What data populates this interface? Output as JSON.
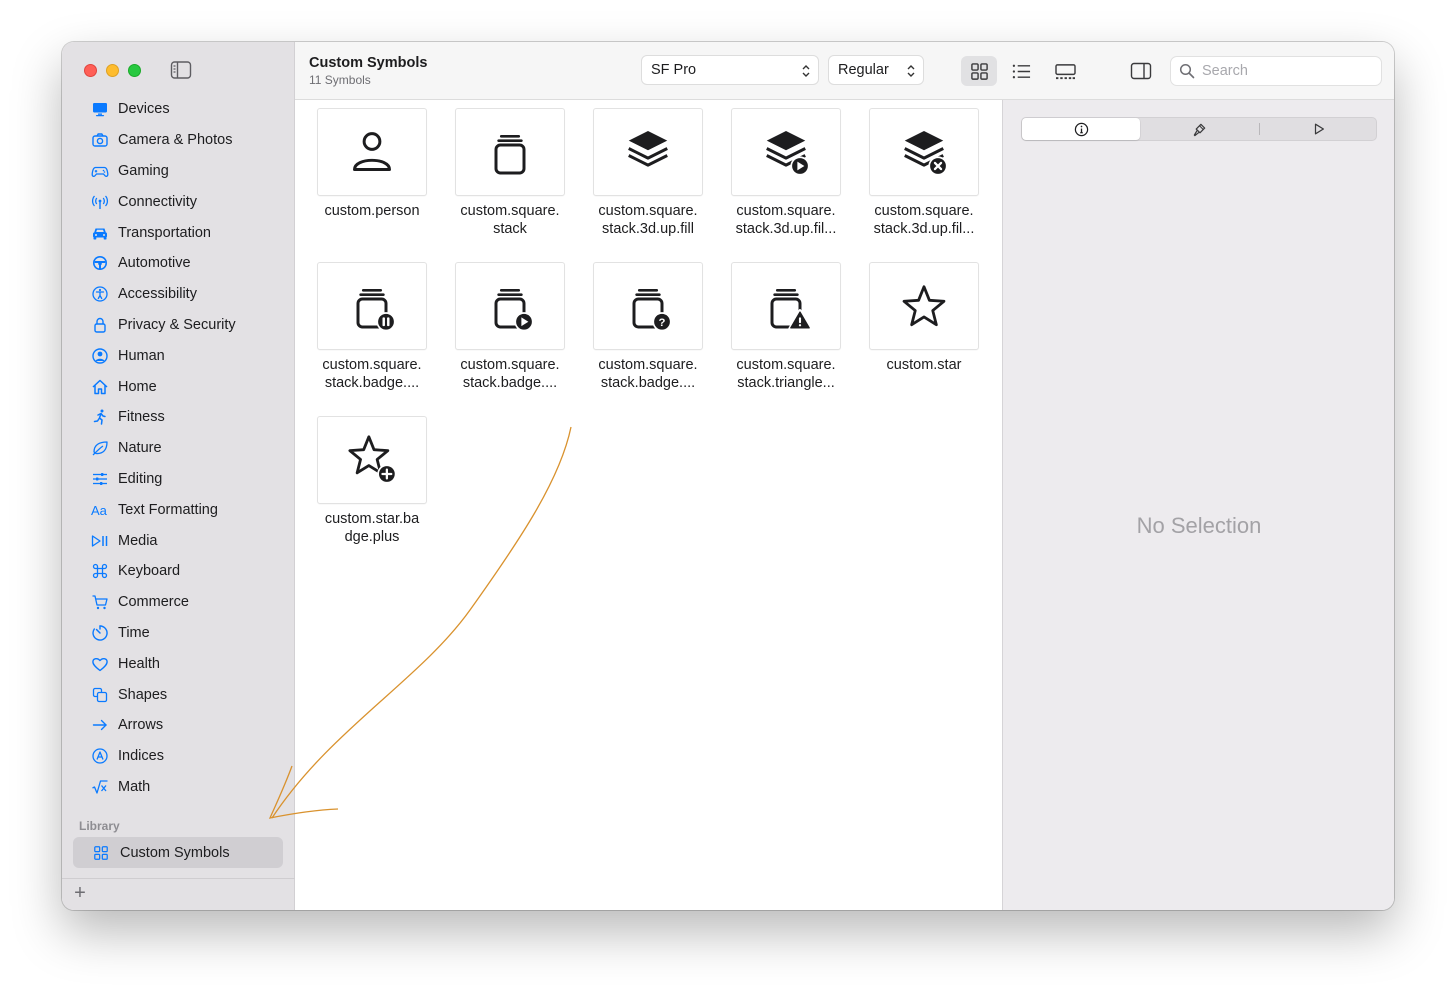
{
  "window": {
    "title": "Custom Symbols",
    "subtitle": "11 Symbols"
  },
  "sidebar": {
    "categories": [
      {
        "label": "Devices",
        "icon": "display-icon"
      },
      {
        "label": "Camera & Photos",
        "icon": "camera-icon"
      },
      {
        "label": "Gaming",
        "icon": "gamecontroller-icon"
      },
      {
        "label": "Connectivity",
        "icon": "antenna-icon"
      },
      {
        "label": "Transportation",
        "icon": "car-icon"
      },
      {
        "label": "Automotive",
        "icon": "steeringwheel-icon"
      },
      {
        "label": "Accessibility",
        "icon": "accessibility-icon"
      },
      {
        "label": "Privacy & Security",
        "icon": "lock-icon"
      },
      {
        "label": "Human",
        "icon": "person-circle-icon"
      },
      {
        "label": "Home",
        "icon": "house-icon"
      },
      {
        "label": "Fitness",
        "icon": "figure-run-icon"
      },
      {
        "label": "Nature",
        "icon": "leaf-icon"
      },
      {
        "label": "Editing",
        "icon": "sliders-icon"
      },
      {
        "label": "Text Formatting",
        "icon": "textformat-icon"
      },
      {
        "label": "Media",
        "icon": "playpause-icon"
      },
      {
        "label": "Keyboard",
        "icon": "command-icon"
      },
      {
        "label": "Commerce",
        "icon": "cart-icon"
      },
      {
        "label": "Time",
        "icon": "timer-icon"
      },
      {
        "label": "Health",
        "icon": "heart-icon"
      },
      {
        "label": "Shapes",
        "icon": "shapes-icon"
      },
      {
        "label": "Arrows",
        "icon": "arrow-right-icon"
      },
      {
        "label": "Indices",
        "icon": "a-circle-icon"
      },
      {
        "label": "Math",
        "icon": "squareroot-icon"
      }
    ],
    "library_label": "Library",
    "library_item": "Custom Symbols",
    "add_label": "+"
  },
  "toolbar": {
    "font_value": "SF Pro",
    "weight_value": "Regular",
    "search_placeholder": "Search"
  },
  "symbols": [
    {
      "label": "custom.person",
      "icon": "person-icon"
    },
    {
      "label": "custom.square.\nstack",
      "icon": "square-stack-icon"
    },
    {
      "label": "custom.square.\nstack.3d.up.fill",
      "icon": "stack-3d-icon"
    },
    {
      "label": "custom.square.\nstack.3d.up.fil...",
      "icon": "stack-3d-play-icon"
    },
    {
      "label": "custom.square.\nstack.3d.up.fil...",
      "icon": "stack-3d-xmark-icon"
    },
    {
      "label": "custom.square.\nstack.badge....",
      "icon": "square-stack-pause-icon"
    },
    {
      "label": "custom.square.\nstack.badge....",
      "icon": "square-stack-play-icon"
    },
    {
      "label": "custom.square.\nstack.badge....",
      "icon": "square-stack-question-icon"
    },
    {
      "label": "custom.square.\nstack.triangle...",
      "icon": "square-stack-triangle-icon"
    },
    {
      "label": "custom.star",
      "icon": "star-icon"
    },
    {
      "label": "custom.star.ba\ndge.plus",
      "icon": "star-plus-icon"
    }
  ],
  "inspector": {
    "empty_text": "No Selection"
  },
  "colors": {
    "accent": "#0a7aff",
    "annotation": "#d9922e",
    "sidebar_bg": "#e3e1e4",
    "inspector_bg": "#edebee"
  }
}
